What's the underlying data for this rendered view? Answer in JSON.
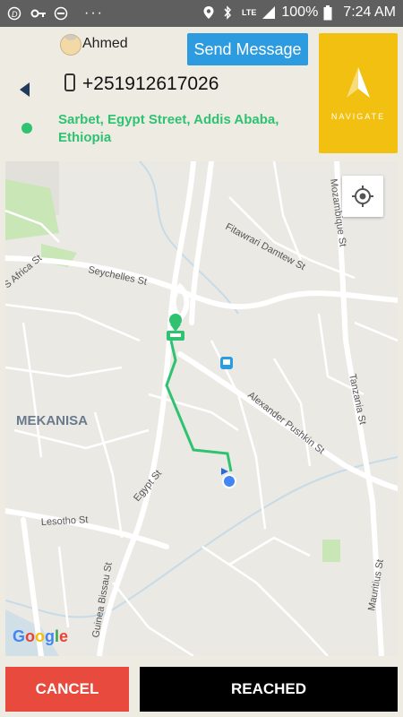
{
  "status_bar": {
    "battery": "100%",
    "time": "7:24 AM",
    "network": "LTE",
    "icons": [
      "d-icon",
      "key-icon",
      "minus-circle-icon",
      "more-icon",
      "location-icon",
      "bluetooth-icon",
      "signal-icon",
      "battery-icon"
    ]
  },
  "contact": {
    "name": "Ahmed",
    "phone": "+251912617026",
    "address": "Sarbet, Egypt Street, Addis Ababa, Ethiopia"
  },
  "actions": {
    "send_message": "Send Message",
    "navigate": "NAVIGATE",
    "cancel": "CANCEL",
    "reached": "REACHED"
  },
  "map": {
    "area_label": "MEKANISA",
    "attribution": "Google",
    "streets": {
      "seychelles": "Seychelles St",
      "fitawrari": "Fitawrari Damtew St",
      "alexander": "Alexander Pushkin St",
      "tanzania": "Tanzania St",
      "mozambique": "Mozambique St",
      "s_africa": "S Africa St",
      "egypt": "Egypt St",
      "lesotho": "Lesotho St",
      "guinea": "Guinea Bissau St",
      "mauritius": "Mauritius St"
    }
  },
  "colors": {
    "route": "#2ec271",
    "send": "#2d9be0",
    "navigate": "#f2c011",
    "cancel": "#e84b3e",
    "reached": "#000000"
  }
}
